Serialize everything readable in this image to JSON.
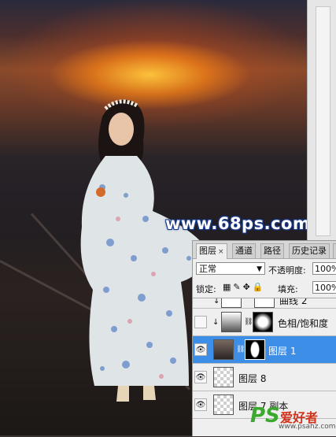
{
  "watermark": "www.68ps.com",
  "layers_panel": {
    "tabs": [
      {
        "label": "图层",
        "close": "×",
        "active": true
      },
      {
        "label": "通道",
        "active": false
      },
      {
        "label": "路径",
        "active": false
      },
      {
        "label": "历史记录",
        "active": false
      },
      {
        "label": "",
        "active": false
      }
    ],
    "blend_mode": "正常",
    "opacity_label": "不透明度:",
    "opacity_value": "100%",
    "lock_label": "锁定:",
    "fill_label": "填充:",
    "fill_value": "100%",
    "layers": [
      {
        "name": "曲线 2",
        "visible": false,
        "selected": false,
        "clipped": true
      },
      {
        "name": "色相/饱和度",
        "visible": false,
        "selected": false,
        "clipped": true
      },
      {
        "name": "图层 1",
        "visible": true,
        "selected": true,
        "clipped": false
      },
      {
        "name": "图层 8",
        "visible": true,
        "selected": false,
        "clipped": false
      },
      {
        "name": "图层 7 副本",
        "visible": true,
        "selected": false,
        "clipped": false
      }
    ]
  },
  "logo": {
    "ps": "PS",
    "cn": "爱好者",
    "url": "www.psahz.com"
  },
  "colors": {
    "selection": "#3d8ee6",
    "watermark_outline": "#1b3b8a",
    "logo_green": "#3aa92e",
    "logo_red": "#d0331c"
  }
}
